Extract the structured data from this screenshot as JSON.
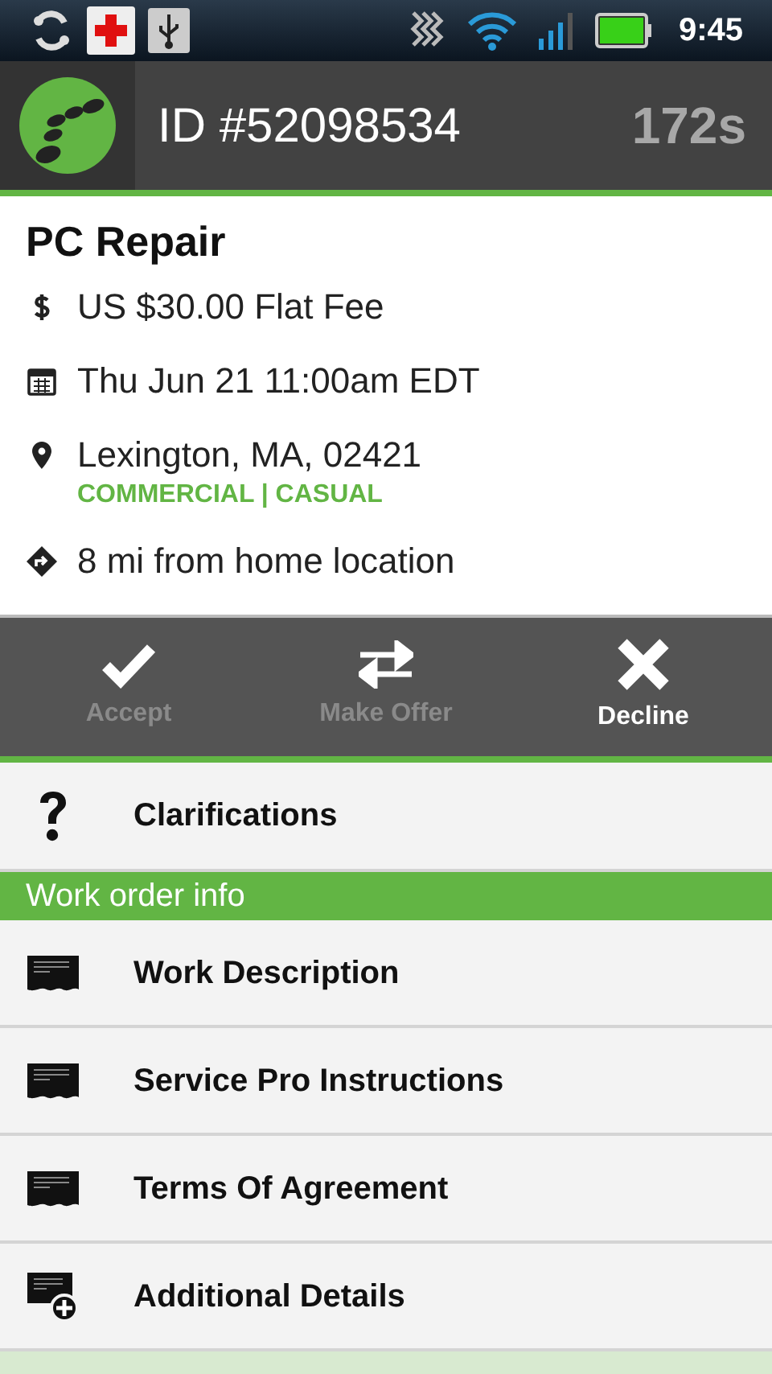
{
  "status_bar": {
    "time": "9:45"
  },
  "header": {
    "id": "ID #52098534",
    "timer": "172s"
  },
  "job": {
    "title": "PC Repair",
    "details": [
      {
        "kind": "fee",
        "text": "US $30.00 Flat Fee"
      },
      {
        "kind": "date",
        "text": "Thu Jun 21 11:00am EDT"
      },
      {
        "kind": "location",
        "text": "Lexington, MA, 02421",
        "tags": "COMMERCIAL | CASUAL"
      },
      {
        "kind": "distance",
        "text": "8 mi from home location"
      }
    ]
  },
  "actions": [
    {
      "kind": "accept",
      "label": "Accept",
      "disabled": true
    },
    {
      "kind": "offer",
      "label": "Make Offer",
      "disabled": true
    },
    {
      "kind": "decline",
      "label": "Decline",
      "disabled": false
    }
  ],
  "clarifications": {
    "kind": "question",
    "label": "Clarifications"
  },
  "section": {
    "title": "Work order info",
    "items": [
      {
        "kind": "document",
        "label": "Work Description"
      },
      {
        "kind": "document",
        "label": "Service Pro Instructions"
      },
      {
        "kind": "document",
        "label": "Terms Of Agreement"
      },
      {
        "kind": "document-add",
        "label": "Additional Details"
      }
    ]
  }
}
